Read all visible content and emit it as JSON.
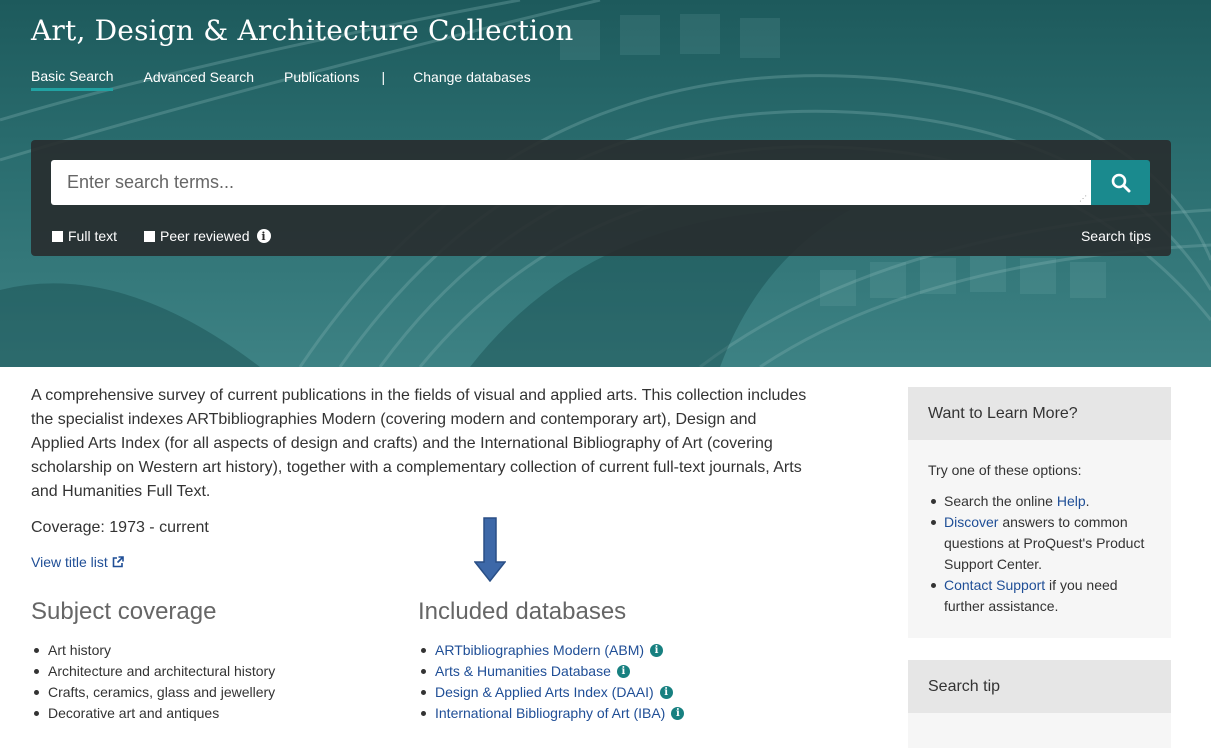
{
  "header": {
    "title": "Art, Design & Architecture Collection",
    "nav": [
      "Basic Search",
      "Advanced Search",
      "Publications"
    ],
    "nav_separator": "|",
    "change_databases": "Change databases"
  },
  "search": {
    "placeholder": "Enter search terms...",
    "full_text_label": "Full text",
    "peer_reviewed_label": "Peer reviewed",
    "search_tips": "Search tips"
  },
  "main": {
    "description": "A comprehensive survey of current publications in the fields of visual and applied arts. This collection includes the specialist indexes ARTbibliographies Modern (covering modern and contemporary art), Design and Applied Arts Index (for all aspects of design and crafts) and the International Bibliography of Art (covering scholarship on Western art history), together with a complementary collection of current full-text journals, Arts and Humanities Full Text.",
    "coverage": "Coverage: 1973 - current",
    "view_title_list": "View title list",
    "subject_heading": "Subject coverage",
    "subjects": [
      "Art history",
      "Architecture and architectural history",
      "Crafts, ceramics, glass and jewellery",
      "Decorative art and antiques"
    ],
    "databases_heading": "Included databases",
    "databases": [
      "ARTbibliographies Modern (ABM)",
      "Arts & Humanities Database",
      "Design & Applied Arts Index (DAAI)",
      "International Bibliography of Art (IBA)"
    ]
  },
  "sidebar": {
    "learn_heading": "Want to Learn More?",
    "learn_intro": "Try one of these options:",
    "opt1_pre": "Search the online ",
    "opt1_link": "Help",
    "opt1_post": ".",
    "opt2_link": "Discover",
    "opt2_post": " answers to common questions at ProQuest's Product Support Center.",
    "opt3_link": "Contact Support",
    "opt3_post": " if you need further assistance.",
    "tip_heading": "Search tip"
  },
  "colors": {
    "accent": "#1a8a8e",
    "link": "#1f4e96",
    "arrow": "#3d68a8"
  }
}
